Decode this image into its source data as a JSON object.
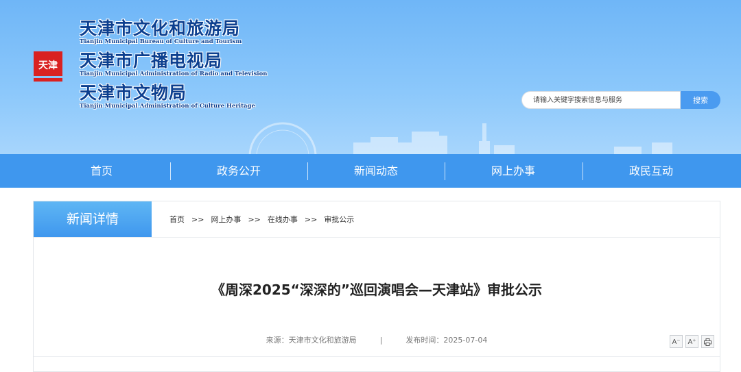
{
  "header": {
    "logo_text": "天津",
    "titles": [
      {
        "cn": "天津市文化和旅游局",
        "en": "Tianjin Municipal Bureau of Culture and Tourism"
      },
      {
        "cn": "天津市广播电视局",
        "en": "Tianjin Municipal Administration of Radio and Television"
      },
      {
        "cn": "天津市文物局",
        "en": "Tianjin Municipal Administration of Culture Heritage"
      }
    ],
    "search": {
      "placeholder": "请输入关键字搜索信息与服务",
      "button_label": "搜索"
    }
  },
  "nav": {
    "items": [
      {
        "label": "首页"
      },
      {
        "label": "政务公开"
      },
      {
        "label": "新闻动态"
      },
      {
        "label": "网上办事"
      },
      {
        "label": "政民互动"
      }
    ]
  },
  "content": {
    "tab_label": "新闻详情",
    "breadcrumb": [
      "首页",
      "网上办事",
      "在线办事",
      "审批公示"
    ],
    "breadcrumb_sep": ">>",
    "article": {
      "title": "《周深2025“深深的”巡回演唱会—天津站》审批公示",
      "source": "来源：天津市文化和旅游局",
      "publish": "发布时间：2025-07-04",
      "meta_sep": "|"
    },
    "tools": {
      "shrink": "A⁻",
      "enlarge": "A⁺"
    }
  }
}
